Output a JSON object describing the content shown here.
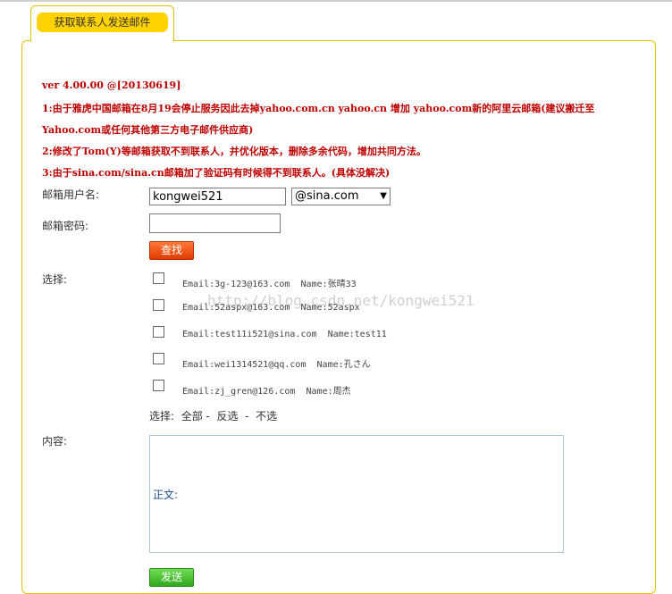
{
  "tab": {
    "title": "获取联系人发送邮件"
  },
  "notes": {
    "version": "ver 4.00.00 @[20130619]",
    "line1": "1:由于雅虎中国邮箱在8月19会停止服务因此去掉yahoo.com.cn yahoo.cn 增加 yahoo.com新的阿里云邮箱(建议搬迁至",
    "line1b": "Yahoo.com或任何其他第三方电子邮件供应商)",
    "line2": "2:修改了Tom(Y)等邮箱获取不到联系人，并优化版本，删除多余代码，增加共同方法。",
    "line3": "3:由于sina.com/sina.cn邮箱加了验证码有时候得不到联系人。(具体没解决)"
  },
  "form": {
    "username_label": "邮箱用户名:",
    "username_value": "kongwei521",
    "domain_selected": "@sina.com",
    "password_label": "邮箱密码:",
    "password_value": "",
    "search_button": "查找",
    "select_label": "选择:",
    "content_label": "内容:",
    "content_text": "正文:",
    "send_button": "发送"
  },
  "contacts": [
    {
      "email": "Email:3g-123@163.com",
      "name": "Name:张晴33"
    },
    {
      "email": "Email:52aspx@163.com",
      "name": "Name:52aspx"
    },
    {
      "email": "Email:test11i521@sina.com",
      "name": "Name:test11"
    },
    {
      "email": "Email:wei1314521@qq.com",
      "name": "Name:孔さん"
    },
    {
      "email": "Email:zj_gren@126.com",
      "name": "Name:周杰"
    }
  ],
  "selection": {
    "label": "选择:",
    "all": "全部",
    "invert": "反选",
    "none": "不选",
    "sep": "-"
  },
  "watermark": "http://blog.csdn.net/kongwei521"
}
